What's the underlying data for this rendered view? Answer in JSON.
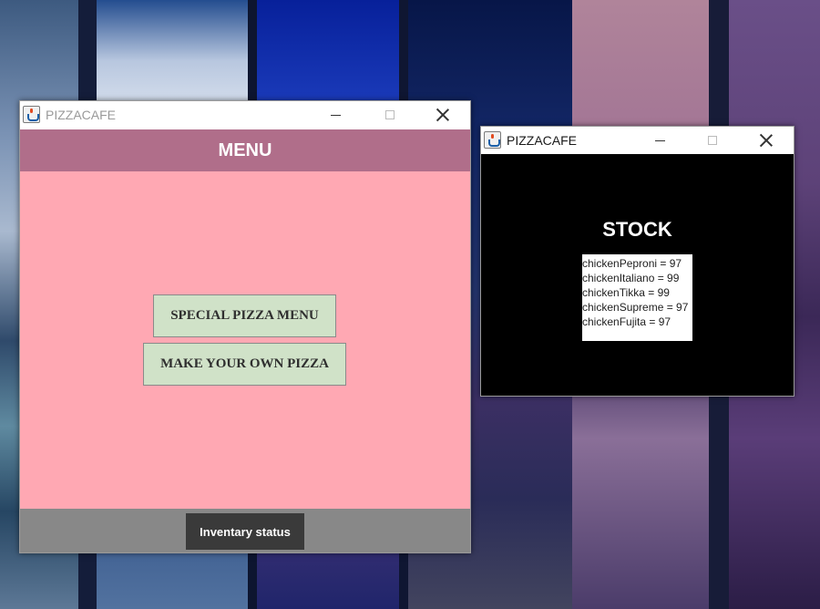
{
  "main_window": {
    "title": "PIZZACAFE",
    "header": "MENU",
    "buttons": {
      "special_pizza_menu": "SPECIAL PIZZA MENU",
      "make_your_own_pizza": "MAKE YOUR OWN PIZZA",
      "inventory_status": "Inventary status"
    }
  },
  "stock_window": {
    "title": "PIZZACAFE",
    "heading": "STOCK",
    "items": [
      "chickenPeproni = 97",
      "chickenItaliano = 99",
      "chickenTikka = 99",
      "chickenSupreme = 97",
      "chickenFujita = 97"
    ]
  },
  "colors": {
    "menu_header": "#b06e8a",
    "menu_body": "#ffa8b3",
    "pizza_button": "#d0e2c8",
    "footer": "#888888",
    "inventory_button": "#3a3a3a",
    "stock_background": "#000000"
  }
}
